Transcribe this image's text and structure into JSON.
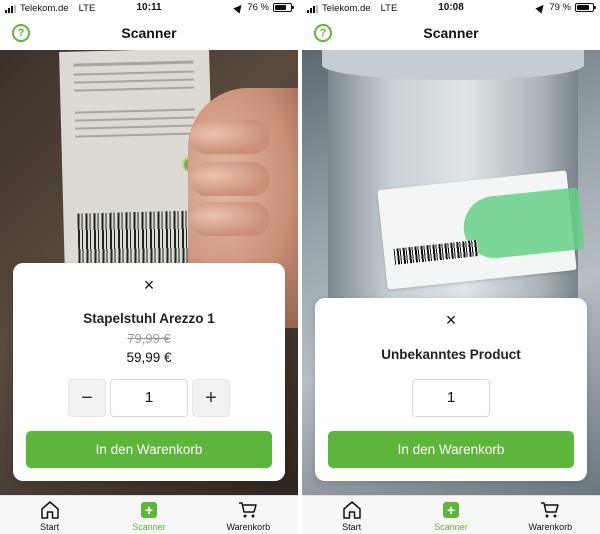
{
  "colors": {
    "accent": "#5db53c",
    "card": "#ffffff",
    "tabbar": "#f7f7f7"
  },
  "screens": [
    {
      "status": {
        "carrier": "Telekom.de",
        "network": "LTE",
        "time": "10:11",
        "battery": "76 %",
        "battery_level": 0.76
      },
      "nav": {
        "title": "Scanner",
        "help_icon": "?"
      },
      "card": {
        "close_icon": "×",
        "product_name": "Stapelstuhl Arezzo 1",
        "old_price": "79,99 €",
        "price": "59,99 €",
        "quantity": "1",
        "minus": "−",
        "plus": "+",
        "cart_button": "In den Warenkorb"
      },
      "tabs": [
        {
          "label": "Start",
          "icon": "home-icon"
        },
        {
          "label": "Scanner",
          "icon": "scanner-icon",
          "active": true
        },
        {
          "label": "Warenkorb",
          "icon": "cart-icon"
        }
      ]
    },
    {
      "status": {
        "carrier": "Telekom.de",
        "network": "LTE",
        "time": "10:08",
        "battery": "79 %",
        "battery_level": 0.79
      },
      "nav": {
        "title": "Scanner",
        "help_icon": "?"
      },
      "card": {
        "close_icon": "×",
        "product_name": "Unbekanntes Product",
        "quantity": "1",
        "cart_button": "In den Warenkorb"
      },
      "tabs": [
        {
          "label": "Start",
          "icon": "home-icon"
        },
        {
          "label": "Scanner",
          "icon": "scanner-icon",
          "active": true
        },
        {
          "label": "Warenkorb",
          "icon": "cart-icon"
        }
      ]
    }
  ]
}
